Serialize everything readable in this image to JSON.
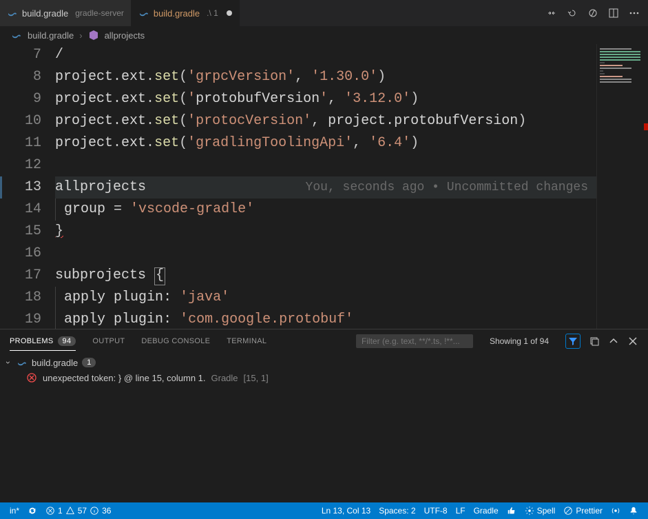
{
  "tabs": [
    {
      "label": "build.gradle",
      "sub": "gradle-server",
      "active": false,
      "modified": false
    },
    {
      "label": "build.gradle",
      "sub": ".\\ 1",
      "active": true,
      "modified": true
    }
  ],
  "tab_actions": [
    "compare-changes-icon",
    "revert-icon",
    "open-changes-icon",
    "split-editor-icon",
    "more-icon"
  ],
  "breadcrumbs": {
    "file": "build.gradle",
    "symbol": "allprojects"
  },
  "editor": {
    "first_line_no": 7,
    "current_line_no": 13,
    "git_annotation": "You, seconds ago • Uncommitted changes",
    "lines": [
      {
        "n": 7,
        "raw": "/"
      },
      {
        "n": 8,
        "raw": "project.ext.set('grpcVersion', '1.30.0')"
      },
      {
        "n": 9,
        "raw": "project.ext.set('protobufVersion', '3.12.0')"
      },
      {
        "n": 10,
        "raw": "project.ext.set('protocVersion', project.protobufVersion)"
      },
      {
        "n": 11,
        "raw": "project.ext.set('gradlingToolingApi', '6.4')"
      },
      {
        "n": 12,
        "raw": ""
      },
      {
        "n": 13,
        "raw": "allprojects "
      },
      {
        "n": 14,
        "raw": "    group = 'vscode-gradle'"
      },
      {
        "n": 15,
        "raw": "}"
      },
      {
        "n": 16,
        "raw": ""
      },
      {
        "n": 17,
        "raw": "subprojects {"
      },
      {
        "n": 18,
        "raw": "    apply plugin: 'java'"
      },
      {
        "n": 19,
        "raw": "    apply plugin: 'com.google.protobuf'"
      }
    ]
  },
  "panel": {
    "tabs": [
      "PROBLEMS",
      "OUTPUT",
      "DEBUG CONSOLE",
      "TERMINAL"
    ],
    "active_tab": "PROBLEMS",
    "problems_count": "94",
    "filter_placeholder": "Filter (e.g. text, **/*.ts, !**...",
    "showing": "Showing 1 of 94",
    "file": {
      "name": "build.gradle",
      "count": "1"
    },
    "items": [
      {
        "message": "unexpected token: } @ line 15, column 1.",
        "source": "Gradle",
        "loc": "[15, 1]"
      }
    ]
  },
  "statusbar": {
    "branch": "in*",
    "errors": "1",
    "warnings": "57",
    "info": "36",
    "cursor": "Ln 13, Col 13",
    "spaces": "Spaces: 2",
    "encoding": "UTF-8",
    "eol": "LF",
    "lang": "Gradle",
    "spell": "Spell",
    "prettier": "Prettier"
  }
}
